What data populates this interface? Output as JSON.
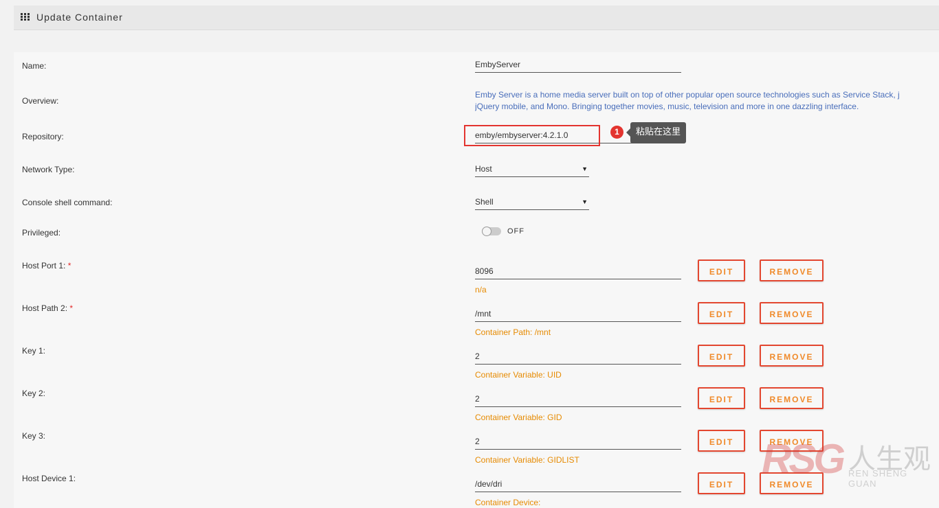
{
  "header": {
    "icon": "apps-grid-icon",
    "title": "Update Container"
  },
  "form": {
    "name": {
      "label": "Name:",
      "value": "EmbyServer"
    },
    "overview": {
      "label": "Overview:",
      "line1": "Emby Server is a home media server built on top of other popular open source technologies such as Service Stack, j",
      "line2": "jQuery mobile, and Mono. Bringing together movies, music, television and more in one dazzling interface."
    },
    "repository": {
      "label": "Repository:",
      "value": "emby/embyserver:4.2.1.0"
    },
    "network_type": {
      "label": "Network Type:",
      "value": "Host"
    },
    "console": {
      "label": "Console shell command:",
      "value": "Shell"
    },
    "privileged": {
      "label": "Privileged:",
      "state": "OFF"
    },
    "host_port_1": {
      "label": "Host Port 1:",
      "required": "*",
      "value": "8096",
      "hint": "n/a"
    },
    "host_path_2": {
      "label": "Host Path 2:",
      "required": "*",
      "value": "/mnt",
      "hint": "Container Path: /mnt"
    },
    "key_1": {
      "label": "Key 1:",
      "value": "2",
      "hint": "Container Variable: UID"
    },
    "key_2": {
      "label": "Key 2:",
      "value": "2",
      "hint": "Container Variable: GID"
    },
    "key_3": {
      "label": "Key 3:",
      "value": "2",
      "hint": "Container Variable: GIDLIST"
    },
    "host_device_1": {
      "label": "Host Device 1:",
      "value": "/dev/dri",
      "hint": "Container Device:"
    }
  },
  "buttons": {
    "edit": "EDIT",
    "remove": "REMOVE"
  },
  "annotation": {
    "number": "1",
    "tooltip": "粘贴在这里",
    "color": "#e3342f"
  },
  "watermark": {
    "logo": "RSG",
    "cn": "人生观",
    "en": "REN SHENG GUAN"
  },
  "colors": {
    "accent": "#f08a2a",
    "button_border": "#e3462f",
    "hint": "#e68a00",
    "link": "#486dba"
  }
}
